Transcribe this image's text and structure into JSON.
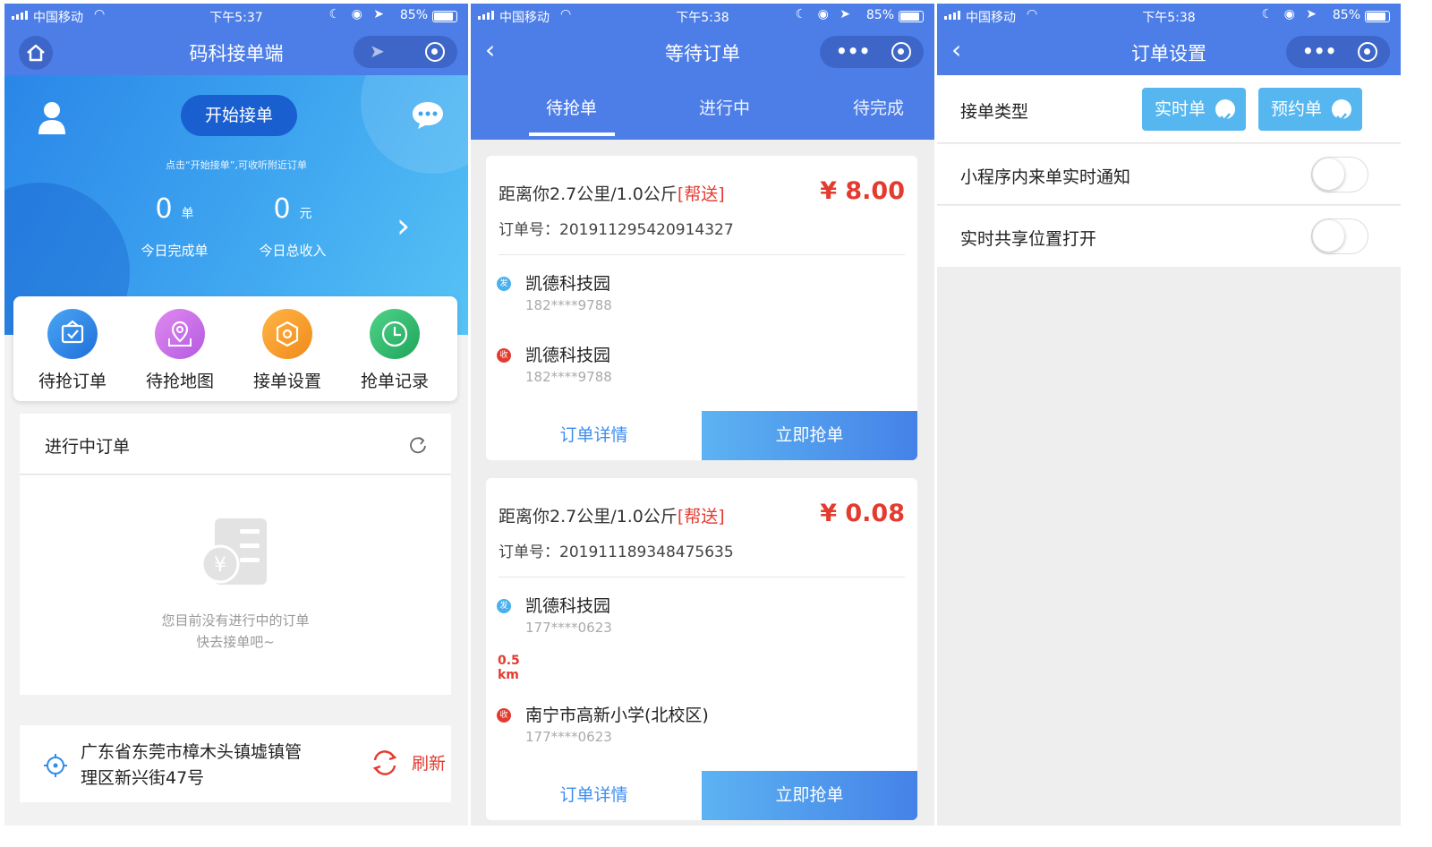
{
  "colors": {
    "primary": "#4d7ee8",
    "price_red": "#e43b30",
    "link_blue": "#3d8df0"
  },
  "status_bars": [
    {
      "carrier": "中国移动",
      "time": "下午5:37",
      "battery": "85%"
    },
    {
      "carrier": "中国移动",
      "time": "下午5:38",
      "battery": "85%"
    },
    {
      "carrier": "中国移动",
      "time": "下午5:38",
      "battery": "85%"
    }
  ],
  "home": {
    "title": "码科接单端",
    "start_button": "开始接单",
    "hint": "点击“开始接单”,可收听附近订单",
    "stats": [
      {
        "value": "0",
        "unit": "单",
        "label": "今日完成单"
      },
      {
        "value": "0",
        "unit": "元",
        "label": "今日总收入"
      }
    ],
    "quick_actions": [
      {
        "label": "待抢订单",
        "icon": "order-check-icon",
        "color": "#2f8de8"
      },
      {
        "label": "待抢地图",
        "icon": "map-pin-icon",
        "color": "#c76ee8"
      },
      {
        "label": "接单设置",
        "icon": "settings-hex-icon",
        "color": "#f59a2a"
      },
      {
        "label": "抢单记录",
        "icon": "clock-icon",
        "color": "#2fba6a"
      }
    ],
    "in_progress": {
      "title": "进行中订单",
      "empty_line1": "您目前没有进行中的订单",
      "empty_line2": "快去接单吧~"
    },
    "location": {
      "address_line1": "广东省东莞市樟木头镇墟镇管",
      "address_line2": "理区新兴街47号",
      "refresh_label": "刷新"
    }
  },
  "orders_page": {
    "title": "等待订单",
    "tabs": [
      "待抢单",
      "进行中",
      "待完成"
    ],
    "orders": [
      {
        "distance": "距离你2.7公里/1.0公斤",
        "tag": "[帮送]",
        "price": "¥ 8.00",
        "order_no": "订单号：201911295420914327",
        "from_badge": "发",
        "from_name": "凯德科技园",
        "from_phone": "182****9788",
        "km_value": "",
        "km_unit": "",
        "to_badge": "收",
        "to_name": "凯德科技园",
        "to_phone": "182****9788",
        "detail_label": "订单详情",
        "grab_label": "立即抢单"
      },
      {
        "distance": "距离你2.7公里/1.0公斤",
        "tag": "[帮送]",
        "price": "¥ 0.08",
        "order_no": "订单号：201911189348475635",
        "from_badge": "发",
        "from_name": "凯德科技园",
        "from_phone": "177****0623",
        "km_value": "0.5",
        "km_unit": "km",
        "to_badge": "收",
        "to_name": "南宁市高新小学(北校区)",
        "to_phone": "177****0623",
        "detail_label": "订单详情",
        "grab_label": "立即抢单"
      }
    ]
  },
  "settings_page": {
    "title": "订单设置",
    "order_type_label": "接单类型",
    "order_types": [
      "实时单",
      "预约单"
    ],
    "notify_label": "小程序内来单实时通知",
    "location_label": "实时共享位置打开"
  }
}
